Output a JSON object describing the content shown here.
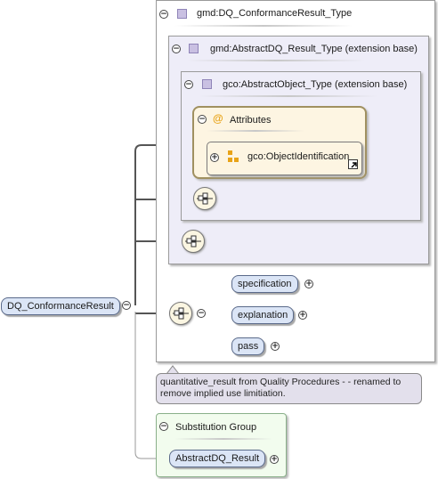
{
  "diagram": {
    "root_element": "DQ_ConformanceResult",
    "type_name": "gmd:DQ_ConformanceResult_Type",
    "extension_1": "gmd:AbstractDQ_Result_Type (extension base)",
    "extension_2": "gco:AbstractObject_Type (extension base)",
    "attributes_label": "Attributes",
    "attribute_group": "gco:ObjectIdentification",
    "child_elements": [
      "specification",
      "explanation",
      "pass"
    ],
    "annotation": "quantitative_result from Quality Procedures - - renamed to remove implied use limitiation.",
    "substitution_group_label": "Substitution Group",
    "substitution_member": "AbstractDQ_Result",
    "attribute_icon_glyph": "@"
  },
  "icons": {
    "collapse": "collapse-minus-icon",
    "expand": "expand-plus-icon",
    "complex_type": "complex-type-icon",
    "attribute": "attribute-at-icon",
    "attribute_group": "attribute-group-icon",
    "sequence": "sequence-compositor-icon",
    "hyperlink": "hyperlink-arrow-icon"
  },
  "colors": {
    "element_fill": "#dbe5f6",
    "element_border": "#5a6a8a",
    "extension_fill": "#eeedf8",
    "attributes_fill": "#fdf5e2",
    "substitution_fill": "#f2fcee",
    "annotation_fill": "#e3e0ec",
    "attribute_icon": "#e8a317"
  }
}
